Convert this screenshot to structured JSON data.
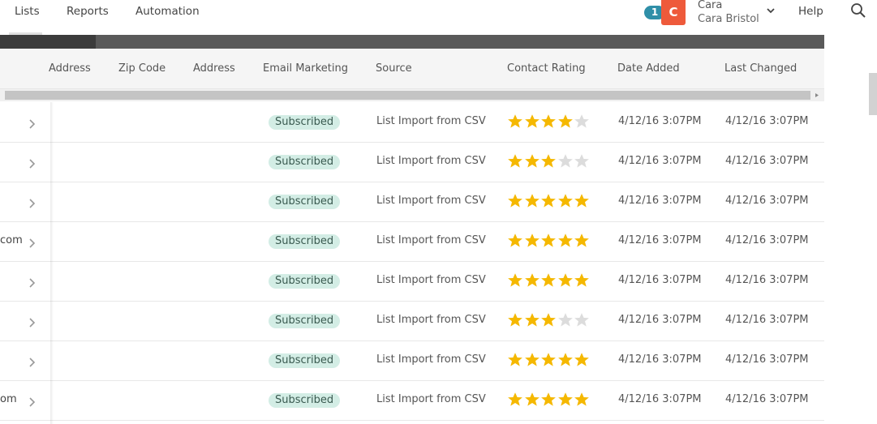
{
  "nav": {
    "items": [
      "Lists",
      "Reports",
      "Automation"
    ],
    "help": "Help"
  },
  "user": {
    "badge_count": "1",
    "avatar_letter": "C",
    "first_name": "Cara",
    "full_name": "Cara Bristol"
  },
  "table": {
    "columns": [
      "Address",
      "Zip Code",
      "Address",
      "Email Marketing",
      "Source",
      "Contact Rating",
      "Date Added",
      "Last Changed"
    ],
    "rows": [
      {
        "email_frag": "",
        "status": "Subscribed",
        "source": "List Import from CSV",
        "rating": 4,
        "date_added": "4/12/16 3:07PM",
        "last_changed": "4/12/16 3:07PM"
      },
      {
        "email_frag": "",
        "status": "Subscribed",
        "source": "List Import from CSV",
        "rating": 3,
        "date_added": "4/12/16 3:07PM",
        "last_changed": "4/12/16 3:07PM"
      },
      {
        "email_frag": "",
        "status": "Subscribed",
        "source": "List Import from CSV",
        "rating": 5,
        "date_added": "4/12/16 3:07PM",
        "last_changed": "4/12/16 3:07PM"
      },
      {
        "email_frag": "com",
        "status": "Subscribed",
        "source": "List Import from CSV",
        "rating": 5,
        "date_added": "4/12/16 3:07PM",
        "last_changed": "4/12/16 3:07PM"
      },
      {
        "email_frag": "",
        "status": "Subscribed",
        "source": "List Import from CSV",
        "rating": 5,
        "date_added": "4/12/16 3:07PM",
        "last_changed": "4/12/16 3:07PM"
      },
      {
        "email_frag": "",
        "status": "Subscribed",
        "source": "List Import from CSV",
        "rating": 3,
        "date_added": "4/12/16 3:07PM",
        "last_changed": "4/12/16 3:07PM"
      },
      {
        "email_frag": "",
        "status": "Subscribed",
        "source": "List Import from CSV",
        "rating": 5,
        "date_added": "4/12/16 3:07PM",
        "last_changed": "4/12/16 3:07PM"
      },
      {
        "email_frag": "om",
        "status": "Subscribed",
        "source": "List Import from CSV",
        "rating": 5,
        "date_added": "4/12/16 3:07PM",
        "last_changed": "4/12/16 3:07PM"
      }
    ]
  },
  "colors": {
    "star_on": "#f5b800",
    "star_off": "#dcdcdc",
    "pill_bg": "#d3ede5",
    "badge": "#2f8fa8",
    "avatar": "#ee5a3b"
  }
}
